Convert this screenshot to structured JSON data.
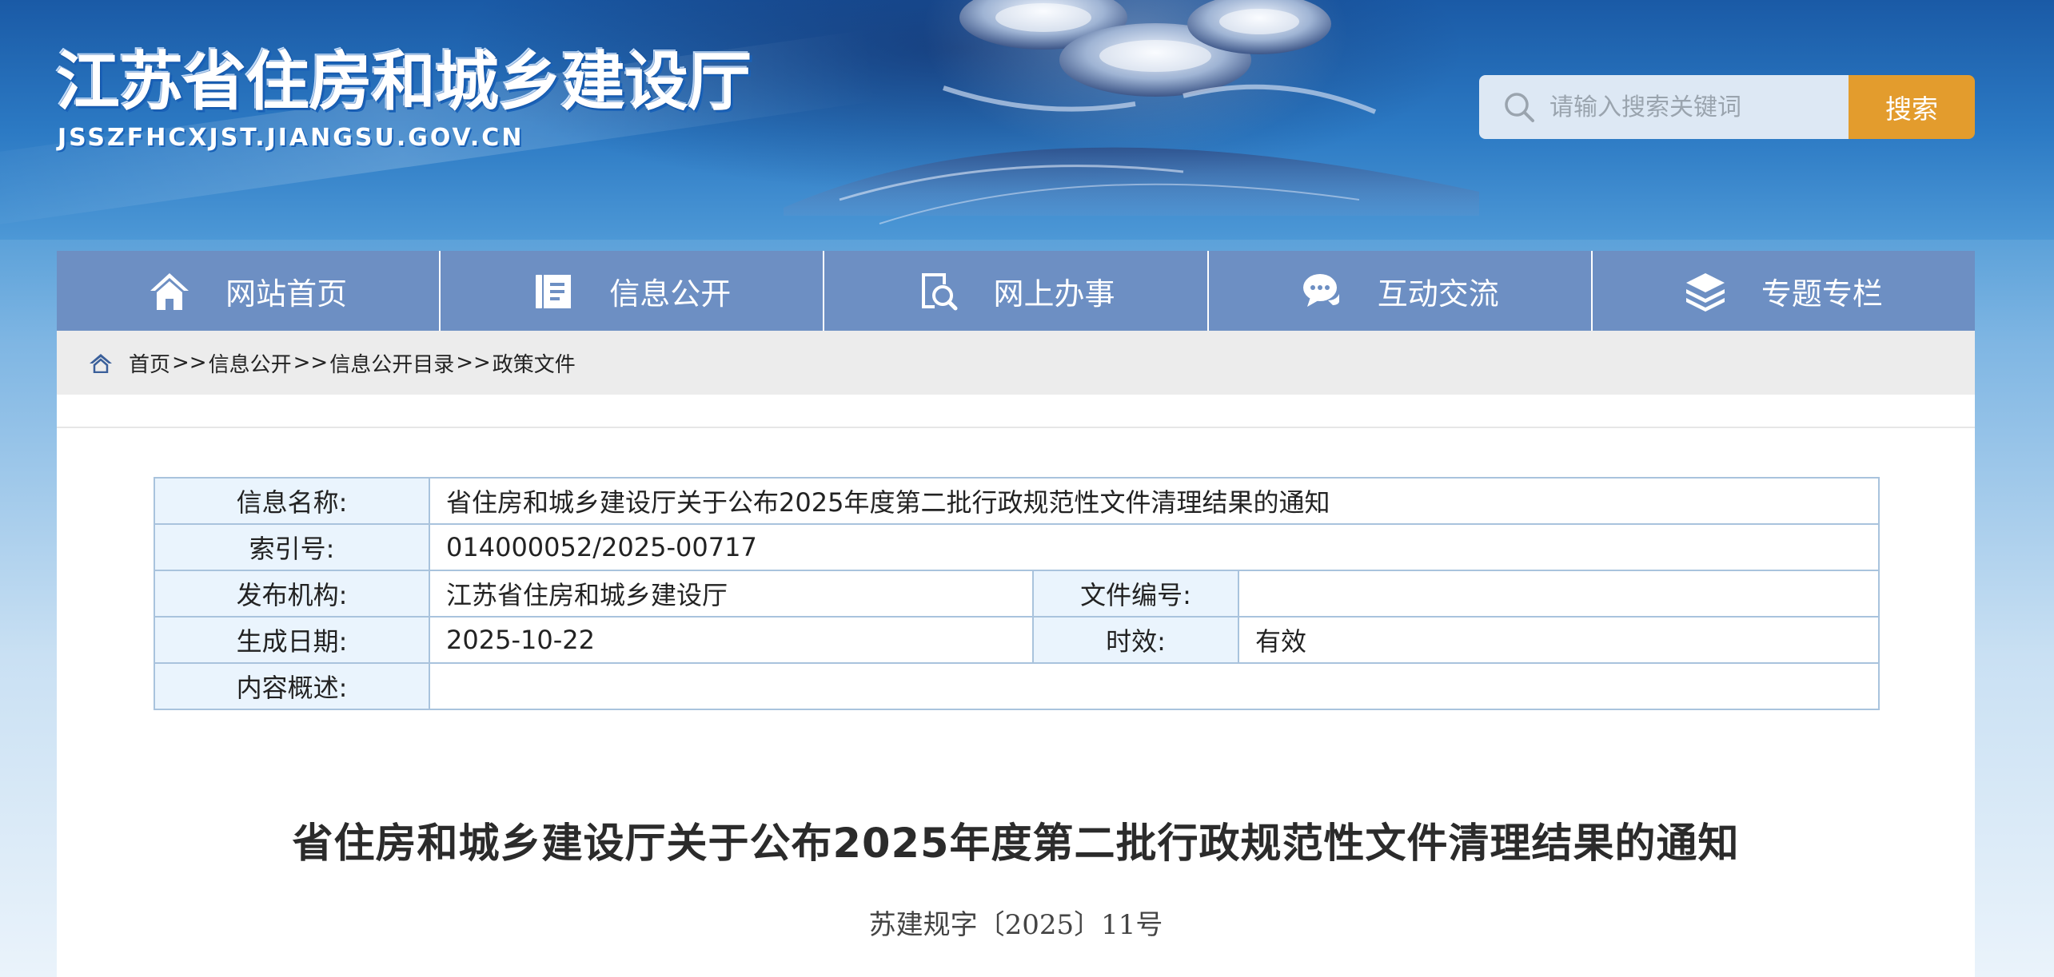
{
  "header": {
    "site_title": "江苏省住房和城乡建设厅",
    "site_domain": "JSSZFHCXJST.JIANGSU.GOV.CN",
    "search": {
      "placeholder": "请输入搜索关键词",
      "button_label": "搜索",
      "button_color": "#e39c2d"
    }
  },
  "nav": {
    "background_color": "#6d8fc3",
    "items": [
      {
        "label": "网站首页",
        "icon": "home-icon"
      },
      {
        "label": "信息公开",
        "icon": "document-icon"
      },
      {
        "label": "网上办事",
        "icon": "search-document-icon"
      },
      {
        "label": "互动交流",
        "icon": "chat-icon"
      },
      {
        "label": "专题专栏",
        "icon": "layers-icon"
      }
    ]
  },
  "breadcrumb": {
    "items": [
      "首页",
      "信息公开",
      "信息公开目录",
      "政策文件"
    ],
    "separator": ">>"
  },
  "meta": {
    "name_label": "信息名称:",
    "name_value": "省住房和城乡建设厅关于公布2025年度第二批行政规范性文件清理结果的通知",
    "index_label": "索引号:",
    "index_value": "014000052/2025-00717",
    "publisher_label": "发布机构:",
    "publisher_value": "江苏省住房和城乡建设厅",
    "file_no_label": "文件编号:",
    "file_no_value": "",
    "date_label": "生成日期:",
    "date_value": "2025-10-22",
    "validity_label": "时效:",
    "validity_value": "有效",
    "summary_label": "内容概述:",
    "summary_value": ""
  },
  "article": {
    "title": "省住房和城乡建设厅关于公布2025年度第二批行政规范性文件清理结果的通知",
    "doc_number": "苏建规字〔2025〕11号"
  }
}
